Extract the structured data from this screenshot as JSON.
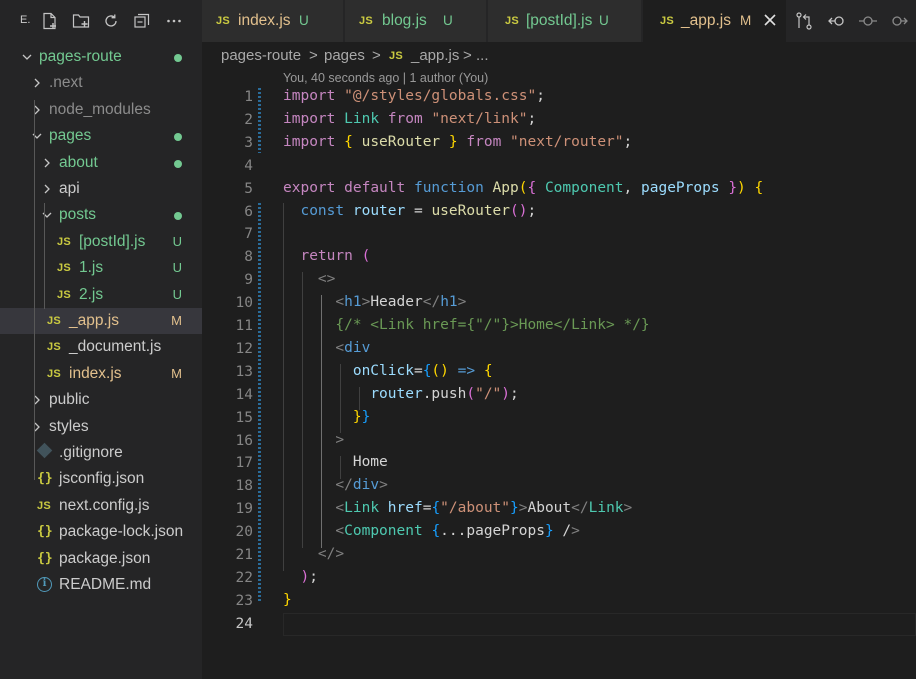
{
  "sidebar": {
    "toolbar": {
      "letter": "E.",
      "icons": [
        "new-file-icon",
        "new-folder-icon",
        "refresh-icon",
        "collapse-all-icon",
        "more-icon"
      ]
    },
    "tree": [
      {
        "label": "pages-route",
        "kind": "folder-open",
        "status": "dot",
        "color": "green"
      },
      {
        "label": ".next",
        "kind": "folder-closed",
        "color": "grey"
      },
      {
        "label": "node_modules",
        "kind": "folder-closed",
        "color": "grey"
      },
      {
        "label": "pages",
        "kind": "folder-open",
        "status": "dot",
        "color": "green"
      },
      {
        "label": "about",
        "kind": "folder-closed",
        "status": "dot",
        "color": "green"
      },
      {
        "label": "api",
        "kind": "folder-closed",
        "color": "white"
      },
      {
        "label": "posts",
        "kind": "folder-open",
        "status": "dot",
        "color": "green"
      },
      {
        "label": "[postId].js",
        "kind": "js",
        "status": "U",
        "color": "green"
      },
      {
        "label": "1.js",
        "kind": "js",
        "status": "U",
        "color": "green"
      },
      {
        "label": "2.js",
        "kind": "js",
        "status": "U",
        "color": "green"
      },
      {
        "label": "_app.js",
        "kind": "js",
        "status": "M",
        "color": "yellow",
        "selected": true
      },
      {
        "label": "_document.js",
        "kind": "js",
        "color": "white"
      },
      {
        "label": "index.js",
        "kind": "js",
        "status": "M",
        "color": "yellow"
      },
      {
        "label": "public",
        "kind": "folder-closed",
        "color": "white"
      },
      {
        "label": "styles",
        "kind": "folder-closed",
        "color": "white"
      },
      {
        "label": ".gitignore",
        "kind": "git",
        "color": "white"
      },
      {
        "label": "jsconfig.json",
        "kind": "json",
        "color": "white"
      },
      {
        "label": "next.config.js",
        "kind": "js",
        "color": "white"
      },
      {
        "label": "package-lock.json",
        "kind": "json",
        "color": "white"
      },
      {
        "label": "package.json",
        "kind": "json",
        "color": "white"
      },
      {
        "label": "README.md",
        "kind": "info",
        "color": "white"
      }
    ]
  },
  "tabs": [
    {
      "badge": "JS",
      "label": "index.js",
      "status": "U"
    },
    {
      "badge": "JS",
      "label": "blog.js",
      "status": "U"
    },
    {
      "badge": "JS",
      "label": "[postId].js",
      "status": "U"
    },
    {
      "badge": "JS",
      "label": "_app.js",
      "status": "M",
      "active": true
    }
  ],
  "editor_actions": [
    "open-changes-icon",
    "go-back-icon",
    "go-forward-circle-icon",
    "go-forward-icon"
  ],
  "breadcrumb": {
    "root": "pages-route",
    "sep": ">",
    "folder": "pages",
    "file_badge": "JS",
    "file": "_app.js",
    "more": "..."
  },
  "codelens": "You, 40 seconds ago | 1 author (You)",
  "code_lines": [
    "1",
    "2",
    "3",
    "4",
    "5",
    "6",
    "7",
    "8",
    "9",
    "10",
    "11",
    "12",
    "13",
    "14",
    "15",
    "16",
    "17",
    "18",
    "19",
    "20",
    "21",
    "22",
    "23",
    "24"
  ],
  "code_text": [
    "import \"@/styles/globals.css\";",
    "import Link from \"next/link\";",
    "import { useRouter } from \"next/router\";",
    "",
    "export default function App({ Component, pageProps }) {",
    "  const router = useRouter();",
    "",
    "  return (",
    "    <>",
    "      <h1>Header</h1>",
    "      {/* <Link href={\"/\"}>Home</Link> */}",
    "      <div",
    "        onClick={() => {",
    "          router.push(\"/\");",
    "        }}",
    "      >",
    "        Home",
    "      </div>",
    "      <Link href={\"/about\"}>About</Link>",
    "      <Component {...pageProps} />",
    "    </>",
    "  );",
    "}",
    ""
  ],
  "colors": {
    "sidebar_bg": "#252526",
    "editor_bg": "#1e1e1e",
    "untracked": "#73c991",
    "modified": "#e2c08d",
    "js_badge": "#cbcb41"
  }
}
